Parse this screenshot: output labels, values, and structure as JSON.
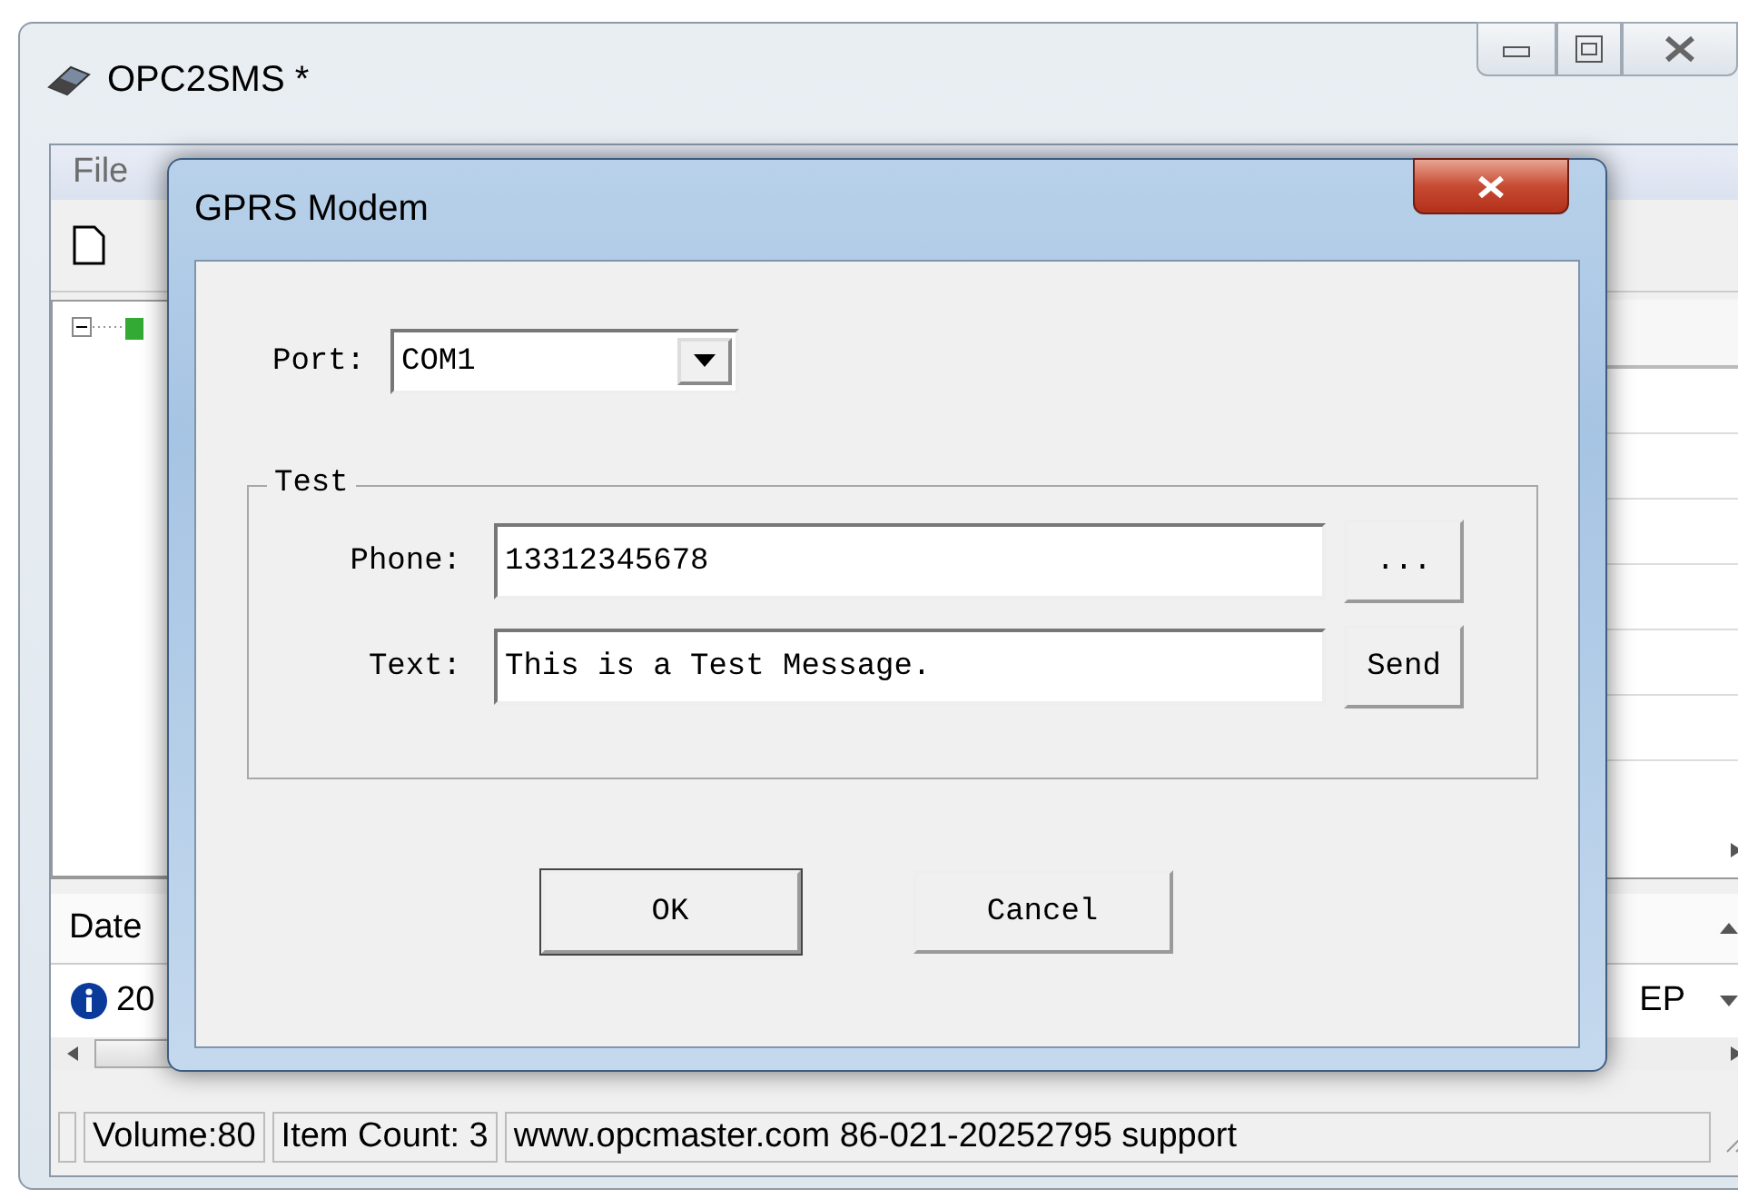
{
  "window": {
    "title": "OPC2SMS *",
    "menu": [
      "File"
    ]
  },
  "log": {
    "columns": [
      "Date"
    ],
    "rows": [
      {
        "cells": [
          "20",
          "EP"
        ]
      }
    ]
  },
  "status_bar": [
    "Volume:80",
    "Item Count: 3",
    "www.opcmaster.com 86-021-20252795 support"
  ],
  "dialog": {
    "title": "GPRS Modem",
    "port": {
      "label": "Port:",
      "value": "COM1"
    },
    "group": {
      "title": "Test",
      "fields": [
        {
          "label": "Phone:",
          "value": "13312345678",
          "button": "..."
        },
        {
          "label": "Text:",
          "value": "This is a Test Message.",
          "button": "Send"
        }
      ]
    },
    "buttons": [
      "OK",
      "Cancel"
    ]
  }
}
